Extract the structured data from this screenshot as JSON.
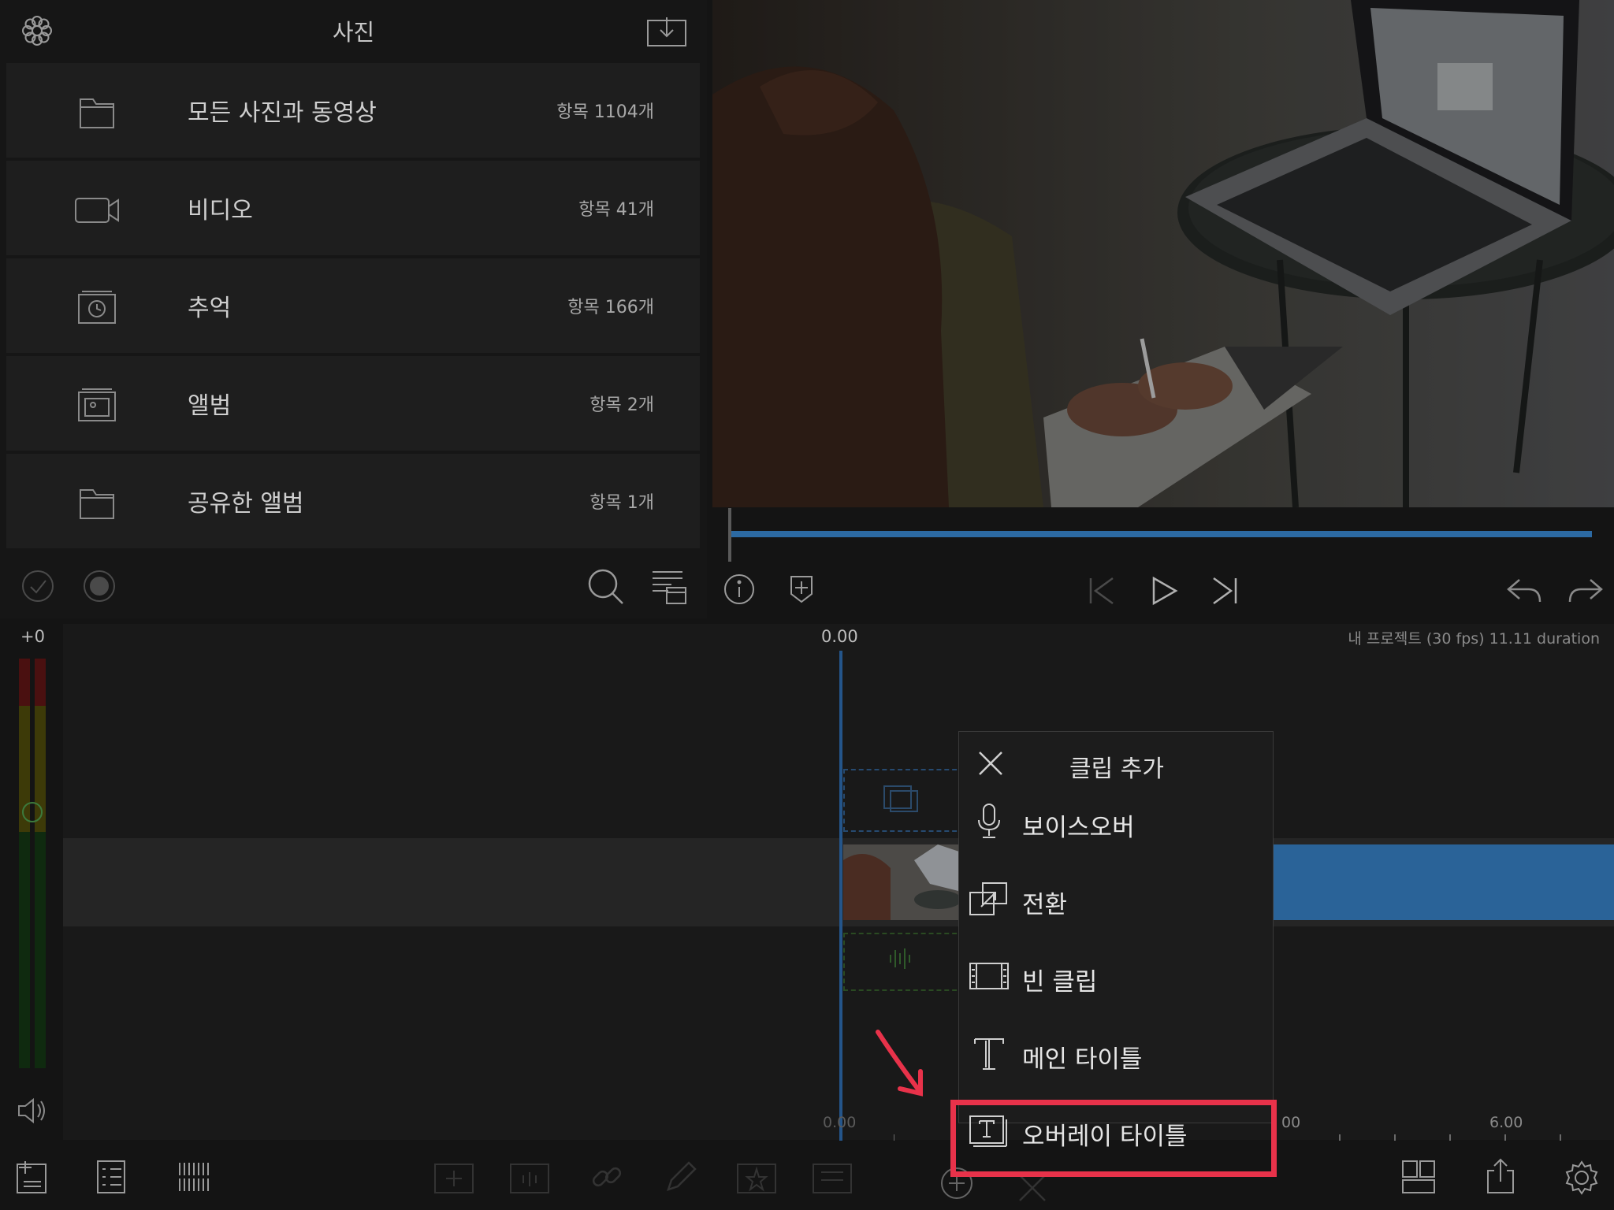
{
  "browser": {
    "title": "사진",
    "items": [
      {
        "label": "모든 사진과 동영상",
        "count": "항목 1104개",
        "icon": "folder-icon"
      },
      {
        "label": "비디오",
        "count": "항목 41개",
        "icon": "video-camera-icon"
      },
      {
        "label": "추억",
        "count": "항목 166개",
        "icon": "memories-icon"
      },
      {
        "label": "앨범",
        "count": "항목 2개",
        "icon": "album-icon"
      },
      {
        "label": "공유한 앨범",
        "count": "항목 1개",
        "icon": "folder-icon"
      }
    ]
  },
  "timeline": {
    "volume_readout": "+0",
    "time_start": "0.00",
    "project_info": "내 프로젝트 (30 fps) 11.11 duration",
    "ruler_start": "0.00",
    "ruler_tick_partial": "00",
    "ruler_tick_end": "6.00"
  },
  "popup": {
    "title": "클립 추가",
    "items": [
      {
        "label": "보이스오버",
        "icon": "microphone-icon"
      },
      {
        "label": "전환",
        "icon": "transition-icon"
      },
      {
        "label": "빈 클립",
        "icon": "film-strip-icon"
      },
      {
        "label": "메인 타이틀",
        "icon": "text-t-icon"
      },
      {
        "label": "오버레이 타이틀",
        "icon": "overlay-title-icon"
      }
    ]
  },
  "colors": {
    "accent": "#2c6aa3",
    "highlight": "#e8324a",
    "clip": "#2a6398"
  }
}
